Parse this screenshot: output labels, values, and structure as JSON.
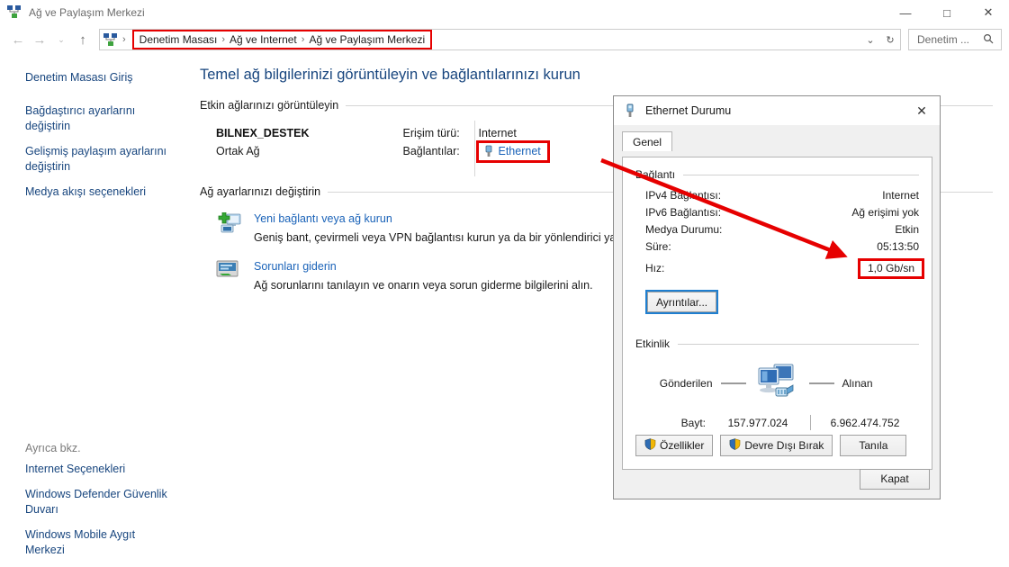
{
  "window": {
    "title": "Ağ ve Paylaşım Merkezi",
    "icon": "network-sharing-icon",
    "minimize_label": "—",
    "maximize_label": "□",
    "close_label": "✕"
  },
  "addressbar": {
    "back_label": "←",
    "forward_label": "→",
    "recent_label": "⌄",
    "up_label": "↑",
    "root_icon": "network-sharing-icon",
    "separator": "›",
    "breadcrumbs": [
      "Denetim Masası",
      "Ağ ve Internet",
      "Ağ ve Paylaşım Merkezi"
    ],
    "dropdown_label": "⌄",
    "refresh_label": "↻",
    "search_placeholder": "Denetim ...",
    "search_icon": "search-icon"
  },
  "sidebar": {
    "items": [
      {
        "label": "Denetim Masası Giriş"
      },
      {
        "label": "Bağdaştırıcı ayarlarını değiştirin"
      },
      {
        "label": "Gelişmiş paylaşım ayarlarını değiştirin"
      },
      {
        "label": "Medya akışı seçenekleri"
      }
    ],
    "see_also_heading": "Ayrıca bkz.",
    "see_also": [
      {
        "label": "Internet Seçenekleri"
      },
      {
        "label": "Windows Defender Güvenlik Duvarı"
      },
      {
        "label": "Windows Mobile Aygıt Merkezi"
      }
    ]
  },
  "main": {
    "page_title": "Temel ağ bilgilerinizi görüntüleyin ve bağlantılarınızı kurun",
    "active_networks_heading": "Etkin ağlarınızı görüntüleyin",
    "active_network": {
      "name": "BILNEX_DESTEK",
      "type": "Ortak Ağ",
      "access_key": "Erişim türü:",
      "access_value": "Internet",
      "connections_key": "Bağlantılar:",
      "connections_value": "Ethernet",
      "connections_icon": "ethernet-port-icon"
    },
    "change_settings_heading": "Ağ ayarlarınızı değiştirin",
    "tasks": [
      {
        "icon": "new-connection-icon",
        "title": "Yeni bağlantı veya ağ kurun",
        "desc": "Geniş bant, çevirmeli veya VPN bağlantısı kurun ya da bir yönlendirici ya da e"
      },
      {
        "icon": "troubleshoot-icon",
        "title": "Sorunları giderin",
        "desc": "Ağ sorunlarını tanılayın ve onarın veya sorun giderme bilgilerini alın."
      }
    ]
  },
  "dialog": {
    "title": "Ethernet Durumu",
    "title_icon": "ethernet-port-icon",
    "close_label": "✕",
    "tab": "Genel",
    "connection_group": "Bağlantı",
    "connection_rows": [
      {
        "key": "IPv4 Bağlantısı:",
        "value": "Internet",
        "boxed": false
      },
      {
        "key": "IPv6 Bağlantısı:",
        "value": "Ağ erişimi yok",
        "boxed": false
      },
      {
        "key": "Medya Durumu:",
        "value": "Etkin",
        "boxed": false
      },
      {
        "key": "Süre:",
        "value": "05:13:50",
        "boxed": false
      },
      {
        "key": "Hız:",
        "value": "1,0 Gb/sn",
        "boxed": true
      }
    ],
    "details_button": "Ayrıntılar...",
    "activity_group": "Etkinlik",
    "activity": {
      "sent_label": "Gönderilen",
      "received_label": "Alınan",
      "diagram_icon": "two-computers-ethernet-icon",
      "bytes_key": "Bayt:",
      "bytes_sent": "157.977.024",
      "bytes_received": "6.962.474.752"
    },
    "buttons": [
      {
        "label": "Özellikler",
        "shield": true
      },
      {
        "label": "Devre Dışı Bırak",
        "shield": true
      },
      {
        "label": "Tanıla",
        "shield": false
      }
    ],
    "close_button": "Kapat"
  },
  "annotations": {
    "highlight_color": "#e60000",
    "details_highlight_color": "#1f7fd0",
    "arrow_from": "ethernet-link-highlight",
    "arrow_to": "speed-value-highlight"
  }
}
